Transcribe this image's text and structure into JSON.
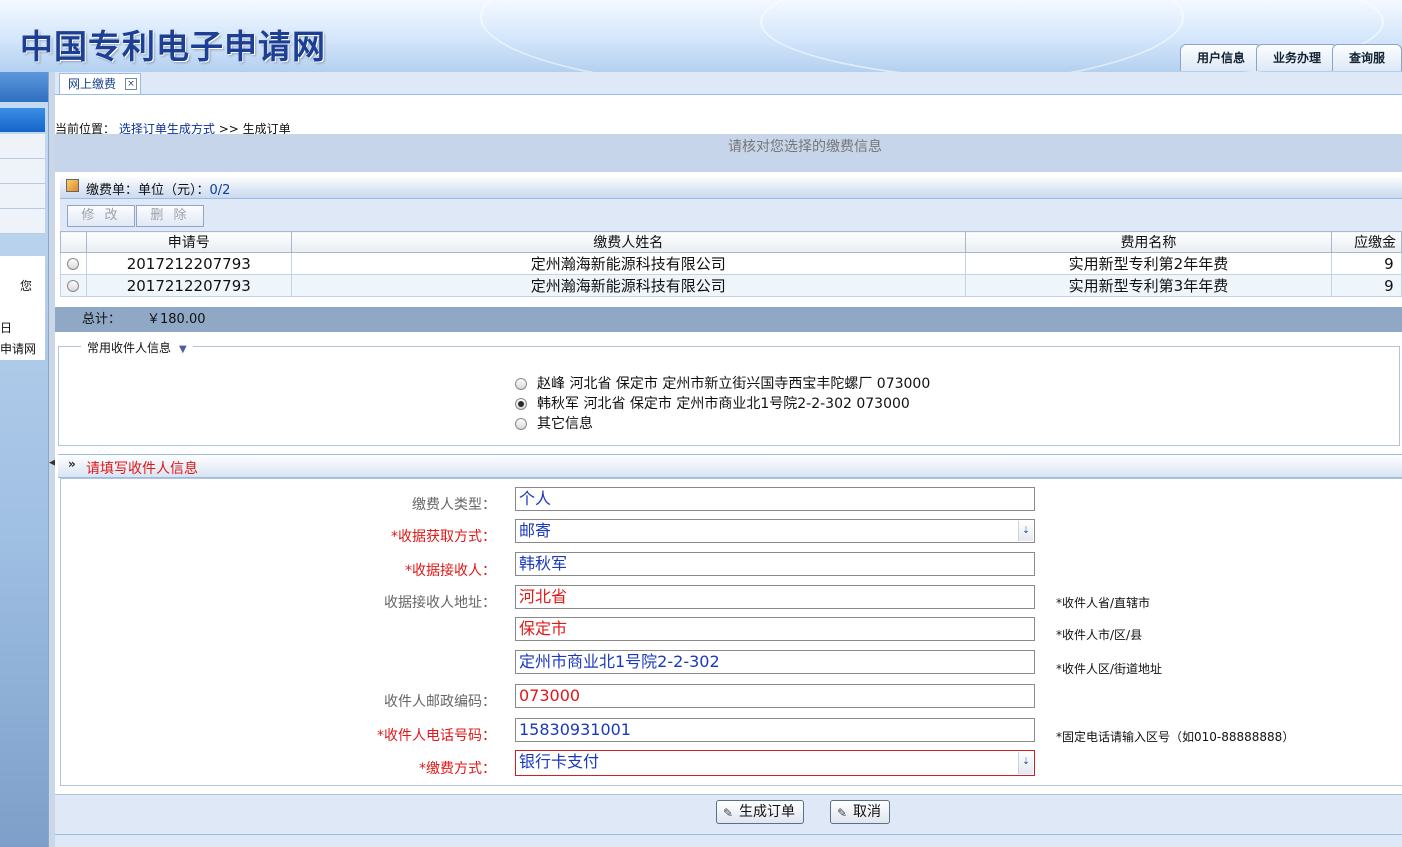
{
  "header": {
    "site_title": "中国专利电子申请网",
    "tabs": [
      "用户信息",
      "业务办理",
      "查询服"
    ]
  },
  "left_panel": {
    "texts": [
      "您",
      "日",
      "申请网"
    ]
  },
  "tab": {
    "label": "网上缴费",
    "close": "×"
  },
  "breadcrumb": {
    "prefix": "当前位置：",
    "link": "选择订单生成方式",
    "sep": ">>",
    "current": "生成订单"
  },
  "notice": "请核对您选择的缴费信息",
  "order_panel": {
    "title": "缴费单：单位（元）：",
    "count": "0/2",
    "toolbar": {
      "edit_label": "修 改",
      "delete_label": "删 除"
    },
    "columns": [
      "申请号",
      "缴费人姓名",
      "费用名称",
      "应缴金"
    ],
    "rows": [
      {
        "app_no": "2017212207793",
        "payer": "定州瀚海新能源科技有限公司",
        "fee_name": "实用新型专利第2年年费",
        "amount": "9"
      },
      {
        "app_no": "2017212207793",
        "payer": "定州瀚海新能源科技有限公司",
        "fee_name": "实用新型专利第3年年费",
        "amount": "9"
      }
    ],
    "total_label": "总计：",
    "total_value": "￥180.00"
  },
  "recipient": {
    "legend": "常用收件人信息",
    "arrow": "▼",
    "options": [
      {
        "label": "赵峰 河北省 保定市 定州市新立街兴国寺西宝丰陀螺厂 073000",
        "selected": false
      },
      {
        "label": "韩秋军 河北省 保定市 定州市商业北1号院2-2-302 073000",
        "selected": true
      },
      {
        "label": "其它信息",
        "selected": false
      }
    ]
  },
  "form": {
    "section_chevron": "»",
    "section_title": "请填写收件人信息",
    "payer_type": {
      "label": "缴费人类型：",
      "value": "个人"
    },
    "receipt_method": {
      "label": "*收据获取方式：",
      "value": "邮寄"
    },
    "receipt_recipient": {
      "label": "*收据接收人：",
      "value": "韩秋军"
    },
    "address_label": "收据接收人地址：",
    "province": {
      "value": "河北省",
      "note": "*收件人省/直辖市"
    },
    "city": {
      "value": "保定市",
      "note": "*收件人市/区/县"
    },
    "street": {
      "value": "定州市商业北1号院2-2-302",
      "note": "*收件人区/街道地址"
    },
    "postcode": {
      "label": "收件人邮政编码：",
      "value": "073000"
    },
    "phone": {
      "label": "*收件人电话号码：",
      "value": "15830931001",
      "note": "*固定电话请输入区号（如010-88888888）"
    },
    "payment_method": {
      "label": "*缴费方式：",
      "value": "银行卡支付"
    },
    "dropdown_glyph": "⇣"
  },
  "actions": {
    "generate_label": "生成订单",
    "cancel_label": "取消",
    "pen": "✎"
  }
}
